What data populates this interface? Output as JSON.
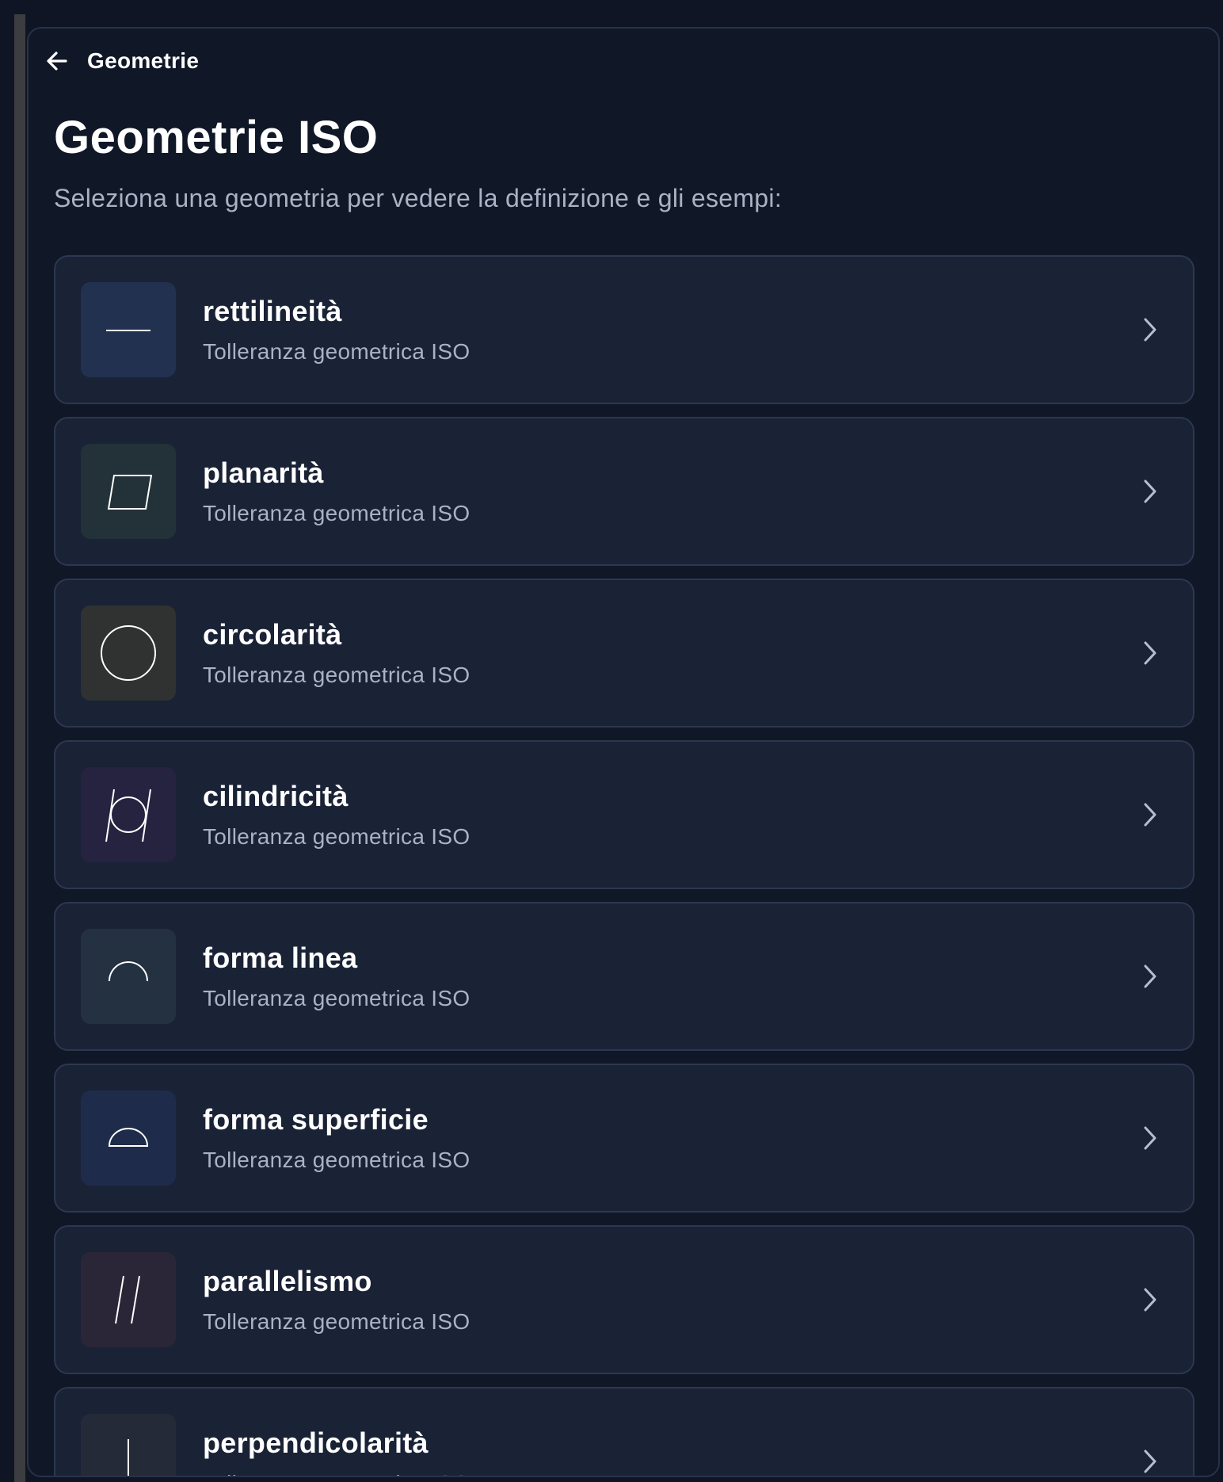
{
  "header": {
    "back_label": "Geometrie"
  },
  "page": {
    "title": "Geometrie ISO",
    "subtitle": "Seleziona una geometria per vedere la definizione e gli esempi:"
  },
  "items": [
    {
      "title": "rettilineità",
      "subtitle": "Tolleranza geometrica ISO",
      "icon": "straightness-icon",
      "icon_bg": "#233150"
    },
    {
      "title": "planarità",
      "subtitle": "Tolleranza geometrica ISO",
      "icon": "flatness-icon",
      "icon_bg": "#233238"
    },
    {
      "title": "circolarità",
      "subtitle": "Tolleranza geometrica ISO",
      "icon": "circularity-icon",
      "icon_bg": "#2f3230"
    },
    {
      "title": "cilindricità",
      "subtitle": "Tolleranza geometrica ISO",
      "icon": "cylindricity-icon",
      "icon_bg": "#252340"
    },
    {
      "title": "forma linea",
      "subtitle": "Tolleranza geometrica ISO",
      "icon": "line-profile-icon",
      "icon_bg": "#233141"
    },
    {
      "title": "forma superficie",
      "subtitle": "Tolleranza geometrica ISO",
      "icon": "surface-profile-icon",
      "icon_bg": "#1f2b4a"
    },
    {
      "title": "parallelismo",
      "subtitle": "Tolleranza geometrica ISO",
      "icon": "parallelism-icon",
      "icon_bg": "#2b2637"
    },
    {
      "title": "perpendicolarità",
      "subtitle": "Tolleranza geometrica ISO",
      "icon": "perpendicularity-icon",
      "icon_bg": "#252a38"
    }
  ]
}
